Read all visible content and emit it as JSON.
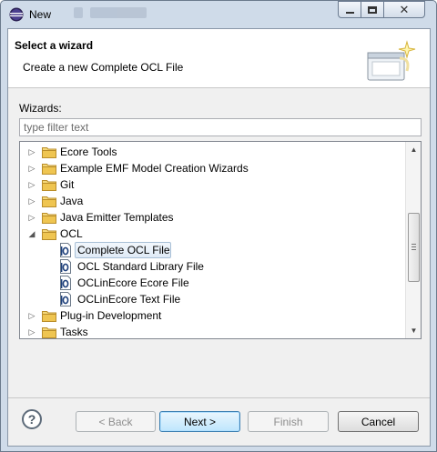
{
  "window": {
    "title": "New"
  },
  "header": {
    "title": "Select a wizard",
    "description": "Create a new Complete OCL File"
  },
  "wizards": {
    "label": "Wizards:",
    "filter_placeholder": "type filter text",
    "filter_value": ""
  },
  "tree": {
    "items": [
      {
        "label": "Ecore Tools",
        "type": "folder",
        "expander": "collapsed"
      },
      {
        "label": "Example EMF Model Creation Wizards",
        "type": "folder",
        "expander": "collapsed"
      },
      {
        "label": "Git",
        "type": "folder",
        "expander": "collapsed"
      },
      {
        "label": "Java",
        "type": "folder",
        "expander": "collapsed"
      },
      {
        "label": "Java Emitter Templates",
        "type": "folder",
        "expander": "collapsed"
      },
      {
        "label": "OCL",
        "type": "folder",
        "expander": "expanded"
      },
      {
        "label": "Complete OCL File",
        "type": "file",
        "selected": true
      },
      {
        "label": "OCL Standard Library File",
        "type": "file"
      },
      {
        "label": "OCLinEcore Ecore File",
        "type": "file"
      },
      {
        "label": "OCLinEcore Text File",
        "type": "file"
      },
      {
        "label": "Plug-in Development",
        "type": "folder",
        "expander": "collapsed"
      },
      {
        "label": "Tasks",
        "type": "folder",
        "expander": "collapsed"
      }
    ]
  },
  "buttons": {
    "help": "?",
    "back": "< Back",
    "next": "Next >",
    "finish": "Finish",
    "cancel": "Cancel"
  },
  "icons": {
    "app": "eclipse-icon",
    "folder": "folder-icon",
    "ocl_file": "ocl-file-icon",
    "wizard_banner": "wizard-banner-icon"
  },
  "colors": {
    "folder_fill": "#e8c45a",
    "selection": "#dfeaf6",
    "default_button_border": "#3c7fb1"
  }
}
